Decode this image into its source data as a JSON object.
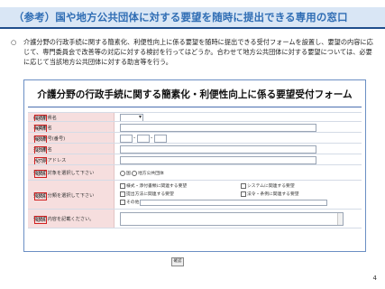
{
  "header": {
    "title": "（参考）国や地方公共団体に対する要望を随時に提出できる専用の窓口"
  },
  "intro": {
    "bullet": "○",
    "text": "介護分野の行政手続に関する簡素化、利便性向上に係る要望を随時に提出できる受付フォームを設置し、要望の内容に応じて、専門委員会で改善等の対応に対する検討を行ってはどうか。合わせて地方公共団体に対する要望については、必要に応じて当該地方公共団体に対する助言等を行う。"
  },
  "form": {
    "title": "介護分野の行政手続に関する簡素化・利便性向上に係る要望受付フォーム",
    "required_mark": "必須",
    "fields": {
      "prefecture": "都道府県名",
      "business_name": "事業者名",
      "phone": "電話番号(番号)",
      "person": "担当者名",
      "email": "メールアドレス",
      "target": "要望の対象を選択して下さい",
      "category": "要望の分類を選択して下さい",
      "detail": "要望の内容を記載ください。"
    },
    "target_options": [
      "国",
      "地方公共団体"
    ],
    "category_options": [
      "様式・添付書類に関連する要望",
      "システムに関連する要望",
      "提出方法に関連する要望",
      "法令・条例に関連する要望",
      "その他"
    ],
    "submit_label": "確認"
  },
  "page_number": "4"
}
